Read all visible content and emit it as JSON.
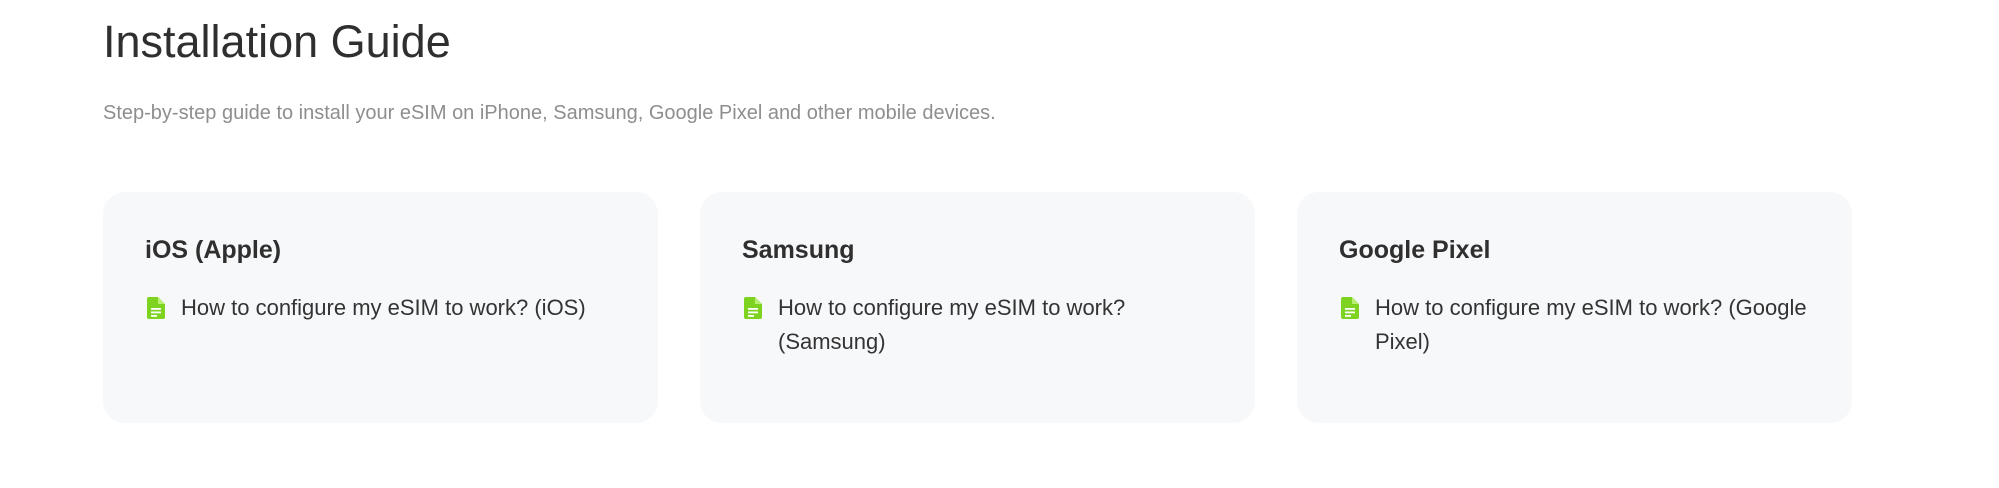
{
  "header": {
    "title": "Installation Guide",
    "subtitle": "Step-by-step guide to install your eSIM on iPhone, Samsung, Google Pixel and other mobile devices."
  },
  "colors": {
    "accent": "#7ed321",
    "card_background": "#f7f8fa",
    "subtitle": "#8e8e8e"
  },
  "cards": [
    {
      "title": "iOS (Apple)",
      "icon": "document-icon",
      "link": "How to configure my eSIM to work? (iOS)"
    },
    {
      "title": "Samsung",
      "icon": "document-icon",
      "link": "How to configure my eSIM to work? (Samsung)"
    },
    {
      "title": "Google Pixel",
      "icon": "document-icon",
      "link": "How to configure my eSIM to work? (Google Pixel)"
    }
  ]
}
